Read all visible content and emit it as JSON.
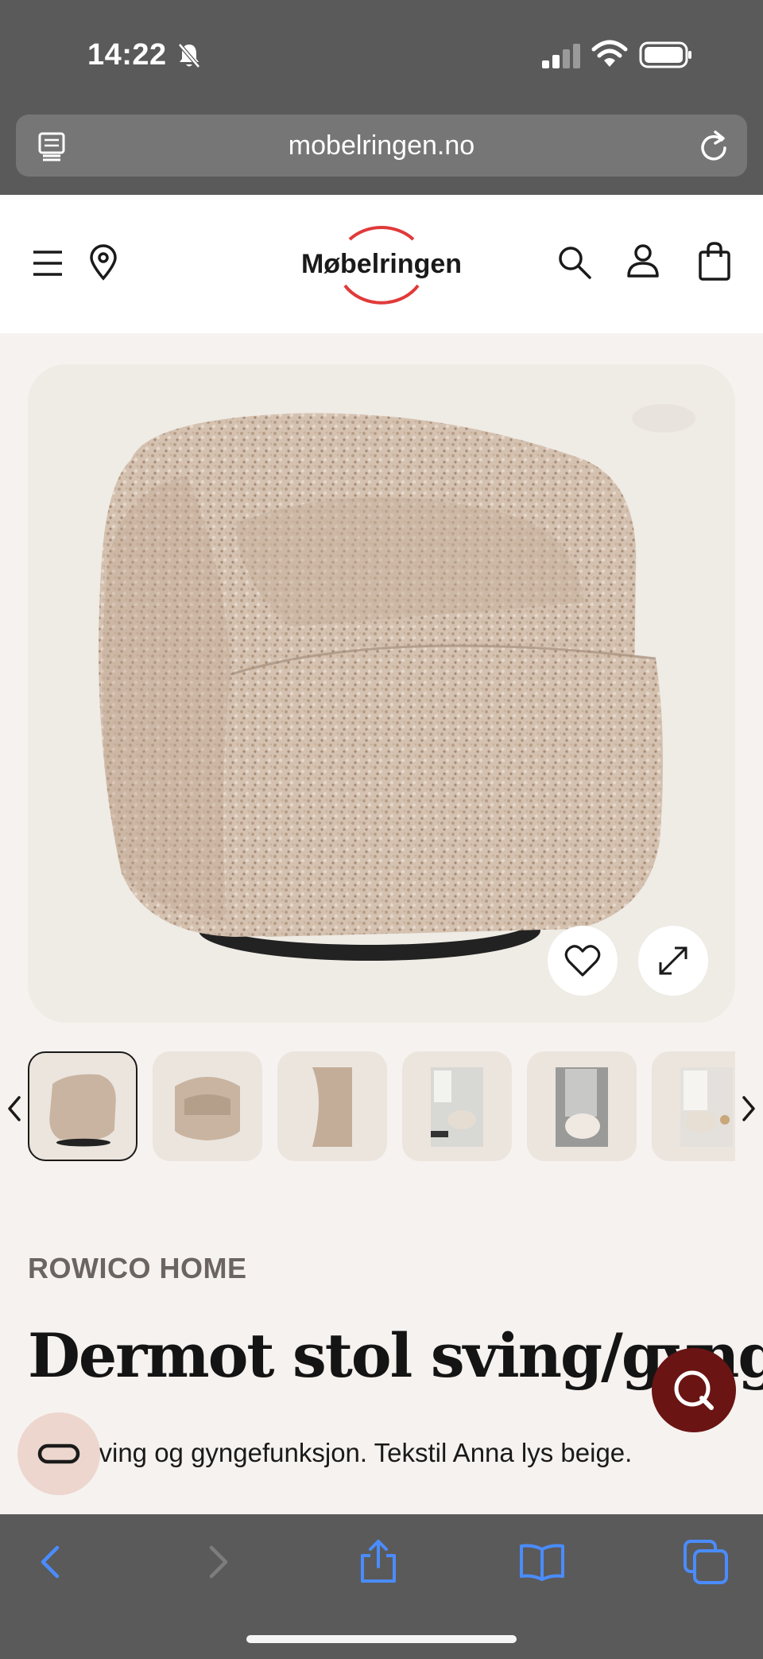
{
  "status_bar": {
    "time": "14:22",
    "icons": [
      "bell-muted-icon",
      "signal-icon",
      "wifi-icon",
      "battery-icon"
    ]
  },
  "browser": {
    "url": "mobelringen.no",
    "icons": [
      "reader-icon",
      "reload-icon"
    ]
  },
  "header": {
    "logo_text": "Møbelringen",
    "brand_color": "#e03a3a",
    "icons": [
      "menu-icon",
      "location-icon",
      "search-icon",
      "account-icon",
      "cart-icon"
    ]
  },
  "gallery": {
    "image": "swivel-armchair-beige-boucle",
    "thumbnail_count": 6,
    "active_thumbnail": 1,
    "icons": [
      "heart-icon",
      "expand-icon",
      "chevron-left-icon",
      "chevron-right-icon"
    ]
  },
  "product": {
    "brand": "ROWICO HOME",
    "title": "Dermot stol sving/gyng",
    "description": "sving og gyngefunksjon. Tekstil Anna lys beige."
  },
  "floating": {
    "chat_color": "#6a1414",
    "compare_color": "#ecd6cd"
  },
  "toolbar": {
    "icons": [
      "back-icon",
      "forward-icon",
      "share-icon",
      "bookmarks-icon",
      "tabs-icon"
    ]
  }
}
